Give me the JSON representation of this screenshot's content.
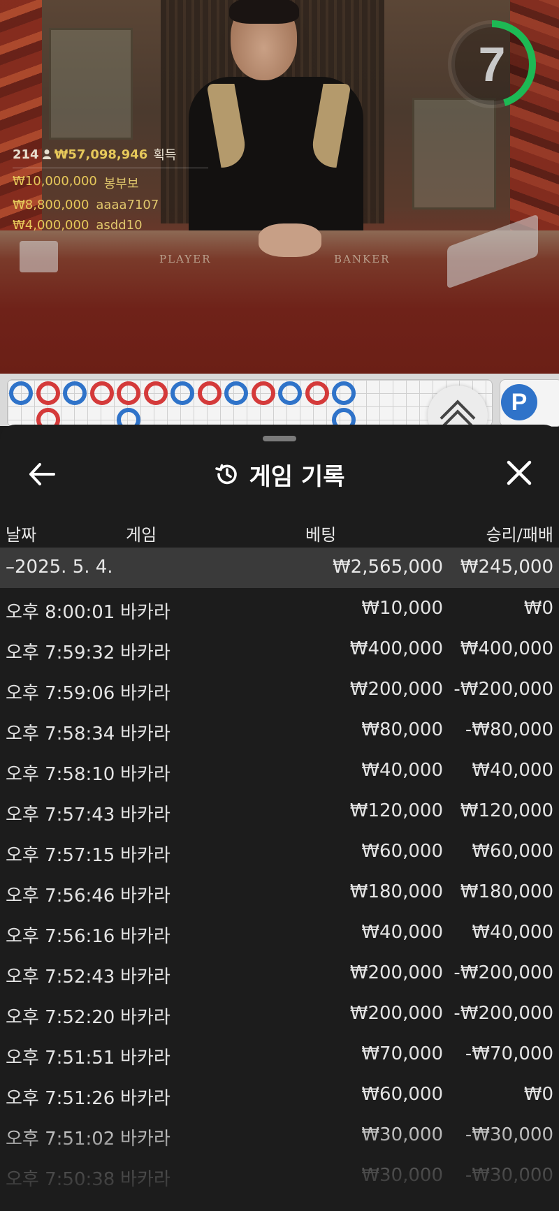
{
  "stream": {
    "winners_summary": {
      "count": "214",
      "total": "₩57,098,946",
      "suffix": "획득"
    },
    "winners": [
      {
        "amount": "₩10,000,000",
        "name": "봉부보"
      },
      {
        "amount": "₩8,800,000",
        "name": "aaaa7107"
      },
      {
        "amount": "₩4,000,000",
        "name": "asdd10"
      }
    ],
    "countdown": "7",
    "countdown_fraction": 0.45,
    "table_labels": {
      "player": "PLAYER",
      "banker": "BANKER"
    },
    "colors": {
      "countdown_ring": "#1db954",
      "winner_gold": "#e6c85a"
    }
  },
  "bead_road": {
    "top_row": [
      "P",
      "B",
      "P",
      "B",
      "B",
      "B",
      "P",
      "B",
      "P",
      "B",
      "P",
      "B",
      "P"
    ],
    "bottom_row": [
      "",
      "B",
      "",
      "",
      "P",
      "",
      "",
      "",
      "",
      "",
      "",
      "",
      "P"
    ],
    "player_badge": "P",
    "colors": {
      "player": "#2f73c9",
      "banker": "#d43a3a"
    }
  },
  "sheet": {
    "title": "게임 기록",
    "icons": {
      "back": "arrow-left-icon",
      "history": "history-icon",
      "close": "close-icon"
    },
    "columns": {
      "date": "날짜",
      "game": "게임",
      "bet": "베팅",
      "result": "승리/패배"
    },
    "day": {
      "label": "–2025. 5. 4.",
      "total_bet": "₩2,565,000",
      "total_result": "₩245,000"
    },
    "rows": [
      {
        "time": "오후 8:00:01",
        "game": "바카라",
        "bet": "₩10,000",
        "result": "₩0"
      },
      {
        "time": "오후 7:59:32",
        "game": "바카라",
        "bet": "₩400,000",
        "result": "₩400,000"
      },
      {
        "time": "오후 7:59:06",
        "game": "바카라",
        "bet": "₩200,000",
        "result": "-₩200,000"
      },
      {
        "time": "오후 7:58:34",
        "game": "바카라",
        "bet": "₩80,000",
        "result": "-₩80,000"
      },
      {
        "time": "오후 7:58:10",
        "game": "바카라",
        "bet": "₩40,000",
        "result": "₩40,000"
      },
      {
        "time": "오후 7:57:43",
        "game": "바카라",
        "bet": "₩120,000",
        "result": "₩120,000"
      },
      {
        "time": "오후 7:57:15",
        "game": "바카라",
        "bet": "₩60,000",
        "result": "₩60,000"
      },
      {
        "time": "오후 7:56:46",
        "game": "바카라",
        "bet": "₩180,000",
        "result": "₩180,000"
      },
      {
        "time": "오후 7:56:16",
        "game": "바카라",
        "bet": "₩40,000",
        "result": "₩40,000"
      },
      {
        "time": "오후 7:52:43",
        "game": "바카라",
        "bet": "₩200,000",
        "result": "-₩200,000"
      },
      {
        "time": "오후 7:52:20",
        "game": "바카라",
        "bet": "₩200,000",
        "result": "-₩200,000"
      },
      {
        "time": "오후 7:51:51",
        "game": "바카라",
        "bet": "₩70,000",
        "result": "-₩70,000"
      },
      {
        "time": "오후 7:51:26",
        "game": "바카라",
        "bet": "₩60,000",
        "result": "₩0"
      },
      {
        "time": "오후 7:51:02",
        "game": "바카라",
        "bet": "₩30,000",
        "result": "-₩30,000"
      },
      {
        "time": "오후 7:50:38",
        "game": "바카라",
        "bet": "₩30,000",
        "result": "-₩30,000"
      }
    ]
  }
}
